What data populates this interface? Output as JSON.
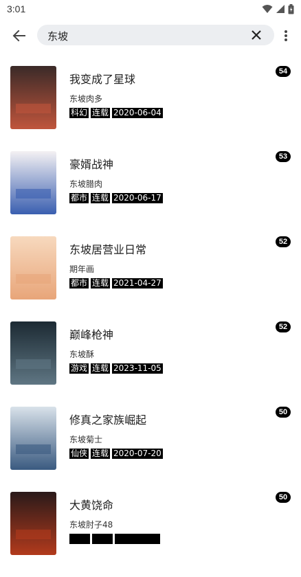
{
  "status_bar": {
    "time": "3:01"
  },
  "search": {
    "query": "东坡"
  },
  "books": [
    {
      "title": "我变成了星球",
      "author": "东坡肉多",
      "tags": [
        "科幻",
        "连载",
        "2020-06-04"
      ],
      "count": "54",
      "cover_colors": [
        "#3a2a28",
        "#c0553c"
      ]
    },
    {
      "title": "豪婿战神",
      "author": "东坡腊肉",
      "tags": [
        "都市",
        "连载",
        "2020-06-17"
      ],
      "count": "53",
      "cover_colors": [
        "#f4f1f3",
        "#3a5fb0"
      ]
    },
    {
      "title": "东坡居营业日常",
      "author": "期年画",
      "tags": [
        "都市",
        "连载",
        "2021-04-27"
      ],
      "count": "52",
      "cover_colors": [
        "#f7d9be",
        "#e8a579"
      ]
    },
    {
      "title": "巅峰枪神",
      "author": "东坡酥",
      "tags": [
        "游戏",
        "连载",
        "2023-11-05"
      ],
      "count": "52",
      "cover_colors": [
        "#1c2a33",
        "#5f7683"
      ]
    },
    {
      "title": "修真之家族崛起",
      "author": "东坡菊士",
      "tags": [
        "仙侠",
        "连载",
        "2020-07-20"
      ],
      "count": "50",
      "cover_colors": [
        "#d9e2ea",
        "#3a5a80"
      ]
    },
    {
      "title": "大黄饶命",
      "author": "东坡肘子48",
      "tags": [
        "",
        "",
        ""
      ],
      "count": "50",
      "cover_colors": [
        "#2a1a1a",
        "#b23a1c"
      ]
    }
  ],
  "icons": {
    "back": "arrow-left-icon",
    "clear": "close-icon",
    "more": "more-vert-icon",
    "wifi": "wifi-icon",
    "signal": "signal-icon",
    "battery": "battery-icon"
  }
}
